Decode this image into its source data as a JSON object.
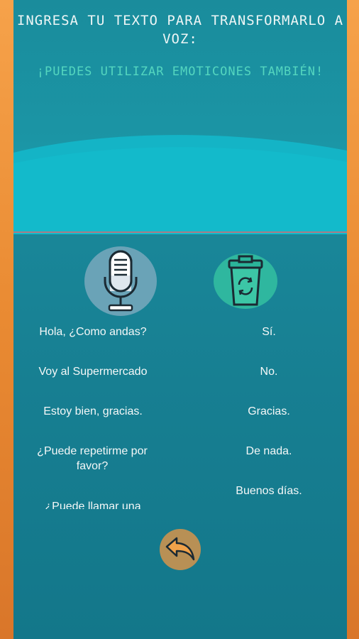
{
  "header": {
    "title": "INGRESA TU TEXTO PARA TRANSFORMARLO A VOZ:",
    "subtitle": "¡PUEDES UTILIZAR EMOTICONES TAMBIÉN!"
  },
  "phrases_left": [
    "Hola, ¿Como andas?",
    "Voy al Supermercado",
    "Estoy bien, gracias.",
    "¿Puede repetirme por favor?",
    "¿Puede llamar una"
  ],
  "phrases_right": [
    "Sí.",
    "No.",
    "Gracias.",
    "De nada.",
    "Buenos días."
  ],
  "icons": {
    "mic": "microphone-icon",
    "trash": "recycle-bin-icon",
    "back": "back-arrow-icon"
  },
  "colors": {
    "frame": "#ef9540",
    "panel": "#1a8a9c",
    "subtitle": "#54d6bf",
    "mic_bg": "#6aa3b7",
    "trash_bg": "#2fb79f",
    "back_bg": "#b89055"
  }
}
